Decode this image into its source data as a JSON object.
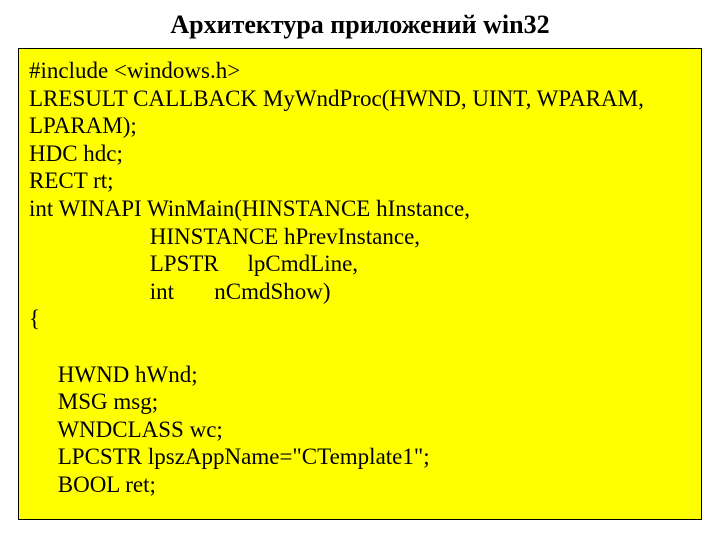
{
  "title": "Архитектура приложений win32",
  "code": {
    "l0": "#include <windows.h>",
    "l1": "LRESULT CALLBACK MyWndProc(HWND, UINT, WPARAM,",
    "l2": "LPARAM);",
    "l3": "HDC hdc;",
    "l4": "RECT rt;",
    "l5": "int WINAPI WinMain(HINSTANCE hInstance,",
    "l6": "                     HINSTANCE hPrevInstance,",
    "l7": "                     LPSTR     lpCmdLine,",
    "l8": "                     int       nCmdShow)",
    "l9": "{",
    "l10": " ",
    "l11": "     HWND hWnd;",
    "l12": "     MSG msg;",
    "l13": "     WNDCLASS wc;",
    "l14": "     LPCSTR lpszAppName=\"CTemplate1\";",
    "l15": "     BOOL ret;"
  }
}
